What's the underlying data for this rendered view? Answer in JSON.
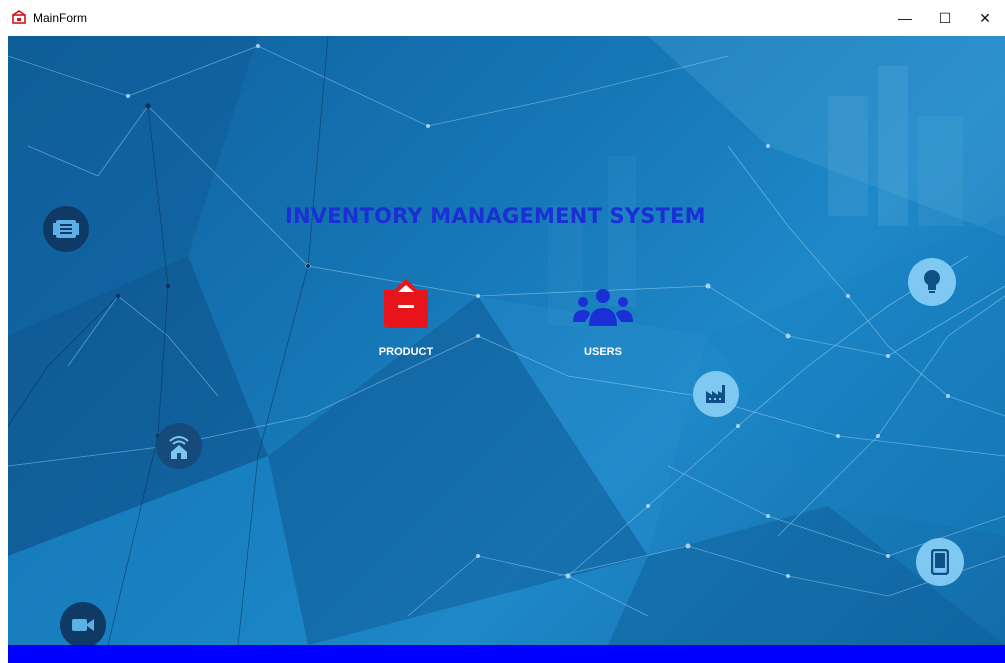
{
  "window": {
    "title": "MainForm",
    "minimize_glyph": "—",
    "maximize_glyph": "☐",
    "close_glyph": "✕"
  },
  "main": {
    "heading": "INVENTORY MANAGEMENT SYSTEM",
    "tiles": [
      {
        "label": "PRODUCT",
        "icon": "box-icon",
        "color": "#e8141c"
      },
      {
        "label": "USERS",
        "icon": "users-icon",
        "color": "#1a2fd6"
      }
    ]
  },
  "decor_icons": [
    "server-icon",
    "wifi-home-icon",
    "video-camera-icon",
    "lightbulb-icon",
    "factory-icon",
    "tablet-icon"
  ],
  "colors": {
    "heading": "#1a2fd6",
    "bottom_bar": "#0000ff",
    "background": "#1676b6"
  }
}
